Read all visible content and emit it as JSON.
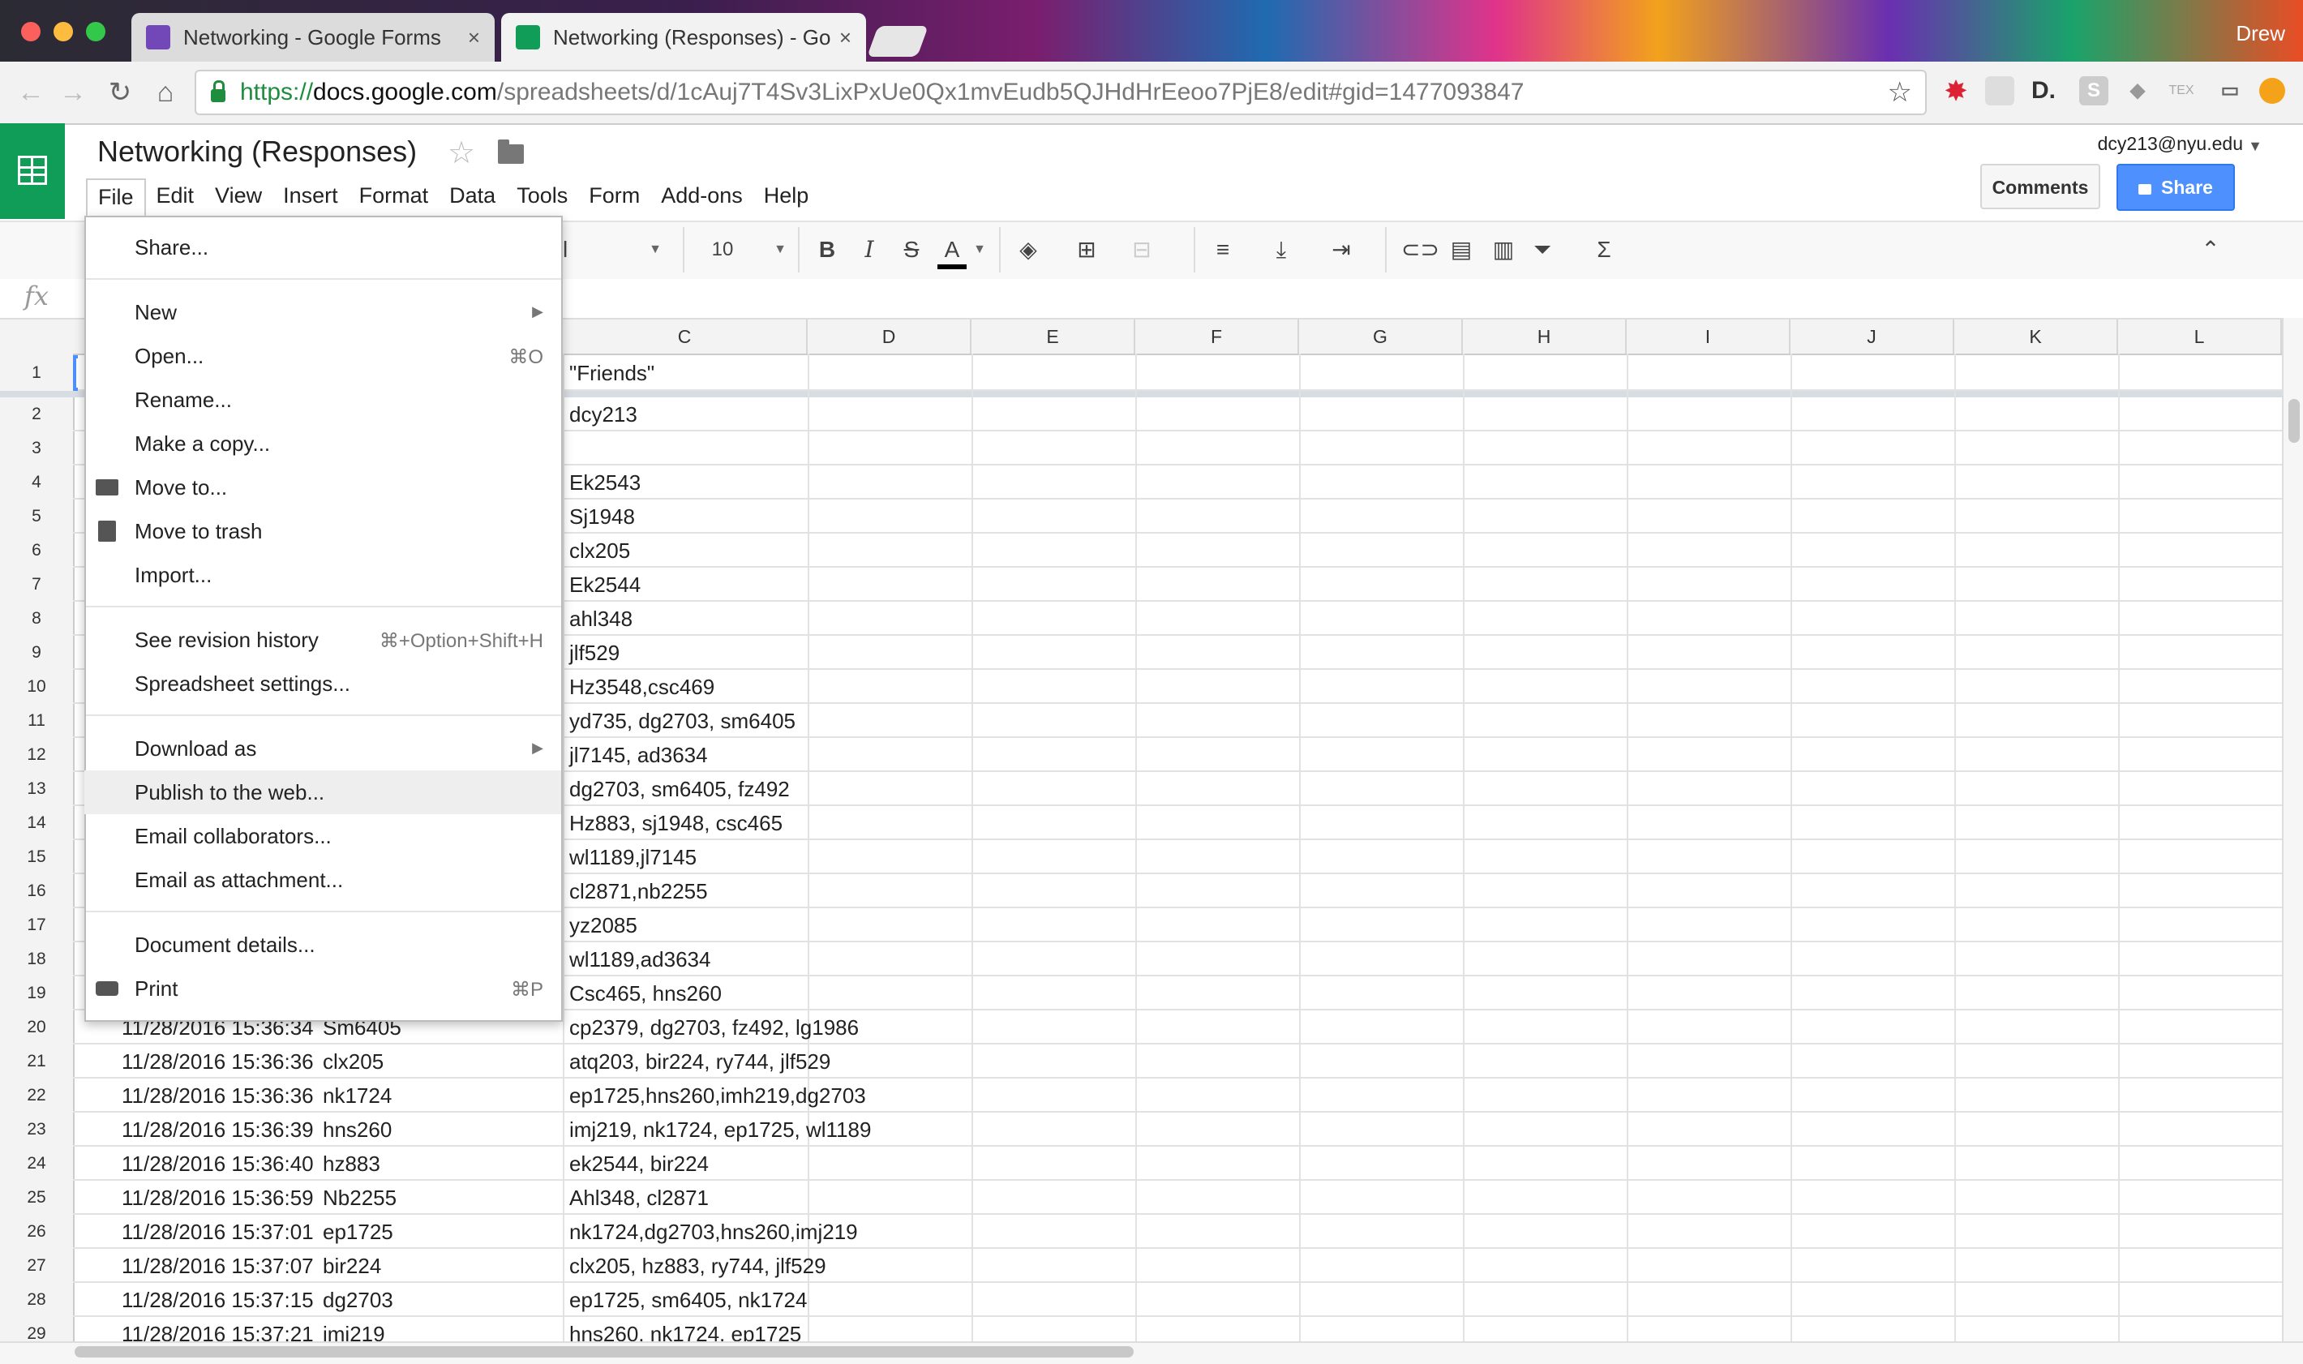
{
  "browser": {
    "tabs": [
      {
        "title": "Networking - Google Forms",
        "icon_color": "#7248b9",
        "active": false
      },
      {
        "title": "Networking (Responses) - Goo",
        "icon_color": "#0f9d58",
        "active": true
      }
    ],
    "user": "Drew",
    "url": {
      "scheme": "https://",
      "host": "docs.google.com",
      "path": "/spreadsheets/d/1cAuj7T4Sv3LixPxUe0Qx1mvEudb5QJHdHrEeoo7PjE8/edit#gid=1477093847"
    },
    "nav_icons": [
      "back-icon",
      "forward-icon",
      "reload-icon",
      "home-icon"
    ],
    "extensions": [
      "lastpass-icon",
      "extension-icon",
      "d-icon",
      "s-icon",
      "dropbox-icon",
      "tex-icon",
      "cast-icon",
      "notification-icon"
    ]
  },
  "doc": {
    "title": "Networking (Responses)",
    "account": "dcy213@nyu.edu",
    "comments_label": "Comments",
    "share_label": "Share",
    "brand_color": "#0f9d58",
    "accent_color": "#4d90fe"
  },
  "menubar": [
    "File",
    "Edit",
    "View",
    "Insert",
    "Format",
    "Data",
    "Tools",
    "Form",
    "Add-ons",
    "Help"
  ],
  "toolbar": {
    "font_size": "10",
    "font_fragment": "l",
    "bold": "B",
    "italic": "I",
    "strike": "S",
    "text_color": "A",
    "icons": [
      "fill-color-icon",
      "borders-icon",
      "merge-icon",
      "align-icon",
      "valign-icon",
      "wrap-icon",
      "link-icon",
      "comment-icon",
      "chart-icon",
      "filter-icon",
      "functions-icon",
      "collapse-icon"
    ],
    "fx": "fx",
    "sigma": "Σ"
  },
  "columns": [
    "C",
    "D",
    "E",
    "F",
    "G",
    "H",
    "I",
    "J",
    "K",
    "L"
  ],
  "rows": [
    {
      "n": "1",
      "a": "",
      "b": "",
      "c": "\"Friends\""
    },
    {
      "n": "2",
      "a": "",
      "b": "",
      "c": "dcy213"
    },
    {
      "n": "3",
      "a": "",
      "b": "",
      "c": ""
    },
    {
      "n": "4",
      "a": "",
      "b": "",
      "c": "Ek2543"
    },
    {
      "n": "5",
      "a": "",
      "b": "",
      "c": "Sj1948"
    },
    {
      "n": "6",
      "a": "",
      "b": "",
      "c": "clx205"
    },
    {
      "n": "7",
      "a": "",
      "b": "",
      "c": "Ek2544"
    },
    {
      "n": "8",
      "a": "",
      "b": "",
      "c": "ahl348"
    },
    {
      "n": "9",
      "a": "",
      "b": "",
      "c": "jlf529"
    },
    {
      "n": "10",
      "a": "",
      "b": "",
      "c": "Hz3548,csc469"
    },
    {
      "n": "11",
      "a": "",
      "b": "",
      "c": "yd735, dg2703, sm6405"
    },
    {
      "n": "12",
      "a": "",
      "b": "",
      "c": "jl7145, ad3634"
    },
    {
      "n": "13",
      "a": "",
      "b": "",
      "c": "dg2703, sm6405, fz492"
    },
    {
      "n": "14",
      "a": "",
      "b": "",
      "c": "Hz883, sj1948, csc465"
    },
    {
      "n": "15",
      "a": "",
      "b": "",
      "c": "wl1189,jl7145"
    },
    {
      "n": "16",
      "a": "",
      "b": "",
      "c": "cl2871,nb2255"
    },
    {
      "n": "17",
      "a": "",
      "b": "",
      "c": "yz2085"
    },
    {
      "n": "18",
      "a": "",
      "b": "",
      "c": "wl1189,ad3634"
    },
    {
      "n": "19",
      "a": "",
      "b": "",
      "c": "Csc465, hns260"
    },
    {
      "n": "20",
      "a": "11/28/2016 15:36:34",
      "b": "Sm6405",
      "c": "cp2379,  dg2703, fz492, lg1986"
    },
    {
      "n": "21",
      "a": "11/28/2016 15:36:36",
      "b": "clx205",
      "c": "atq203, bir224, ry744, jlf529"
    },
    {
      "n": "22",
      "a": "11/28/2016 15:36:36",
      "b": "nk1724",
      "c": "ep1725,hns260,imh219,dg2703"
    },
    {
      "n": "23",
      "a": "11/28/2016 15:36:39",
      "b": "hns260",
      "c": "imj219, nk1724, ep1725, wl1189"
    },
    {
      "n": "24",
      "a": "11/28/2016 15:36:40",
      "b": "hz883",
      "c": "ek2544, bir224"
    },
    {
      "n": "25",
      "a": "11/28/2016 15:36:59",
      "b": "Nb2255",
      "c": "Ahl348, cl2871"
    },
    {
      "n": "26",
      "a": "11/28/2016 15:37:01",
      "b": "ep1725",
      "c": "nk1724,dg2703,hns260,imj219"
    },
    {
      "n": "27",
      "a": "11/28/2016 15:37:07",
      "b": "bir224",
      "c": "clx205, hz883, ry744, jlf529"
    },
    {
      "n": "28",
      "a": "11/28/2016 15:37:15",
      "b": "dg2703",
      "c": "ep1725, sm6405, nk1724"
    },
    {
      "n": "29",
      "a": "11/28/2016 15:37:21",
      "b": "imj219",
      "c": "hns260, nk1724, ep1725"
    }
  ],
  "file_menu": {
    "items": [
      {
        "label": "Share...",
        "shortcut": "",
        "submenu": false,
        "icon": ""
      },
      {
        "label": "New",
        "shortcut": "",
        "submenu": true,
        "icon": ""
      },
      {
        "label": "Open...",
        "shortcut": "⌘O",
        "submenu": false,
        "icon": ""
      },
      {
        "label": "Rename...",
        "shortcut": "",
        "submenu": false,
        "icon": ""
      },
      {
        "label": "Make a copy...",
        "shortcut": "",
        "submenu": false,
        "icon": ""
      },
      {
        "label": "Move to...",
        "shortcut": "",
        "submenu": false,
        "icon": "folder-icon"
      },
      {
        "label": "Move to trash",
        "shortcut": "",
        "submenu": false,
        "icon": "trash-icon"
      },
      {
        "label": "Import...",
        "shortcut": "",
        "submenu": false,
        "icon": ""
      },
      {
        "label": "See revision history",
        "shortcut": "⌘+Option+Shift+H",
        "submenu": false,
        "icon": ""
      },
      {
        "label": "Spreadsheet settings...",
        "shortcut": "",
        "submenu": false,
        "icon": ""
      },
      {
        "label": "Download as",
        "shortcut": "",
        "submenu": true,
        "icon": ""
      },
      {
        "label": "Publish to the web...",
        "shortcut": "",
        "submenu": false,
        "icon": "",
        "highlighted": true
      },
      {
        "label": "Email collaborators...",
        "shortcut": "",
        "submenu": false,
        "icon": ""
      },
      {
        "label": "Email as attachment...",
        "shortcut": "",
        "submenu": false,
        "icon": ""
      },
      {
        "label": "Document details...",
        "shortcut": "",
        "submenu": false,
        "icon": ""
      },
      {
        "label": "Print",
        "shortcut": "⌘P",
        "submenu": false,
        "icon": "print-icon"
      }
    ]
  }
}
